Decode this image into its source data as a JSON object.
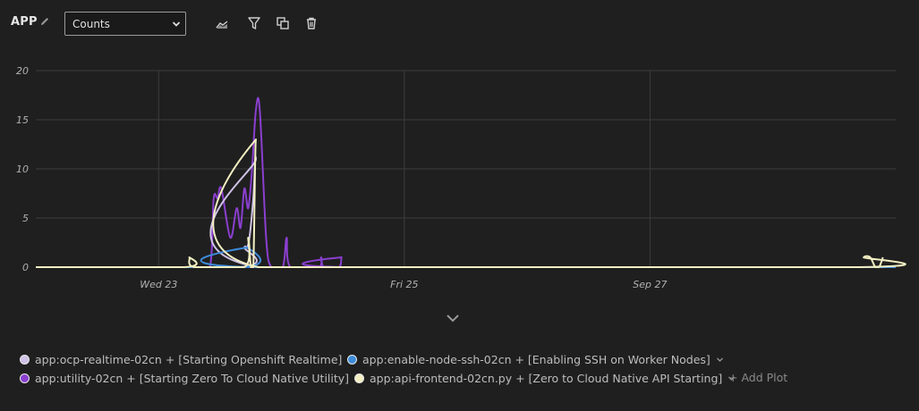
{
  "header": {
    "title": "APP",
    "metric_options": [
      "Counts"
    ],
    "metric_selected": "Counts"
  },
  "colors": {
    "background": "#1f1f1f",
    "grid": "#3c3c3c",
    "series_ocp": "#cfc2e6",
    "series_ssh": "#3d8bd9",
    "series_utility": "#8a3fcf",
    "series_api": "#f3efc2"
  },
  "chart_data": {
    "type": "line",
    "x_range": [
      "Sep 22 00:00",
      "Sep 29 00:00"
    ],
    "ylim": [
      0,
      20
    ],
    "y_ticks": [
      "0",
      "5",
      "10",
      "15",
      "20"
    ],
    "x_ticks": [
      {
        "label": "Wed 23",
        "t": "Sep 23 00:00"
      },
      {
        "label": "Fri 25",
        "t": "Sep 25 00:00"
      },
      {
        "label": "Sep 27",
        "t": "Sep 27 00:00"
      }
    ],
    "grid": true,
    "series": [
      {
        "name": "app:utility-02cn + [Starting Zero To Cloud Native Utility]",
        "color_key": "series_utility",
        "points": [
          [
            "Sep 22 00:00",
            0
          ],
          [
            "Sep 23 07:00",
            0
          ],
          [
            "Sep 23 10:00",
            0
          ],
          [
            "Sep 23 10:45",
            7
          ],
          [
            "Sep 23 11:30",
            7
          ],
          [
            "Sep 23 12:15",
            8
          ],
          [
            "Sep 23 14:00",
            3
          ],
          [
            "Sep 23 15:15",
            6
          ],
          [
            "Sep 23 16:00",
            4
          ],
          [
            "Sep 23 16:45",
            8
          ],
          [
            "Sep 23 17:30",
            6
          ],
          [
            "Sep 23 18:15",
            10
          ],
          [
            "Sep 23 19:00",
            16
          ],
          [
            "Sep 23 19:45",
            16
          ],
          [
            "Sep 23 21:00",
            3
          ],
          [
            "Sep 23 22:00",
            0
          ],
          [
            "Sep 24 00:15",
            0
          ],
          [
            "Sep 24 01:00",
            3
          ],
          [
            "Sep 24 01:45",
            0
          ],
          [
            "Sep 24 07:15",
            0
          ],
          [
            "Sep 24 07:45",
            1
          ],
          [
            "Sep 24 08:15",
            0
          ],
          [
            "Sep 24 11:15",
            0
          ],
          [
            "Sep 24 11:45",
            1
          ],
          [
            "Sep 24 12:15",
            0
          ],
          [
            "Sep 29 00:00",
            0
          ]
        ]
      },
      {
        "name": "app:ocp-realtime-02cn + [Starting Openshift Realtime]",
        "color_key": "series_ocp",
        "points": [
          [
            "Sep 22 00:00",
            0
          ],
          [
            "Sep 23 16:00",
            0
          ],
          [
            "Sep 23 16:45",
            2
          ],
          [
            "Sep 23 17:15",
            2
          ],
          [
            "Sep 23 17:45",
            3
          ],
          [
            "Sep 23 18:30",
            7
          ],
          [
            "Sep 23 19:00",
            11
          ],
          [
            "Sep 23 19:30",
            0
          ],
          [
            "Sep 29 00:00",
            0
          ]
        ]
      },
      {
        "name": "app:enable-node-ssh-02cn + [Enabling SSH on Worker Nodes]",
        "color_key": "series_ssh",
        "points": [
          [
            "Sep 22 00:00",
            0
          ],
          [
            "Sep 23 16:45",
            0
          ],
          [
            "Sep 23 17:15",
            2
          ],
          [
            "Sep 23 17:45",
            0
          ],
          [
            "Sep 29 00:00",
            0
          ]
        ]
      },
      {
        "name": "app:api-frontend-02cn.py + [Zero to Cloud Native API Starting]",
        "color_key": "series_api",
        "points": [
          [
            "Sep 22 00:00",
            0
          ],
          [
            "Sep 23 05:00",
            0
          ],
          [
            "Sep 23 06:00",
            1
          ],
          [
            "Sep 23 07:00",
            0
          ],
          [
            "Sep 23 16:45",
            0
          ],
          [
            "Sep 23 17:30",
            3
          ],
          [
            "Sep 23 18:00",
            0
          ],
          [
            "Sep 23 18:30",
            0
          ],
          [
            "Sep 23 19:00",
            13
          ],
          [
            "Sep 23 19:30",
            0
          ],
          [
            "Sep 28 17:00",
            0
          ],
          [
            "Sep 28 17:45",
            1
          ],
          [
            "Sep 28 19:00",
            1
          ],
          [
            "Sep 28 20:00",
            0
          ],
          [
            "Sep 28 20:45",
            0
          ],
          [
            "Sep 28 21:30",
            1
          ]
        ]
      }
    ]
  },
  "legend": {
    "items": [
      {
        "label": "app:ocp-realtime-02cn + [Starting Openshift Realtime]",
        "color_key": "series_ocp"
      },
      {
        "label": "app:enable-node-ssh-02cn + [Enabling SSH on Worker Nodes]",
        "color_key": "series_ssh"
      },
      {
        "label": "app:utility-02cn + [Starting Zero To Cloud Native Utility]",
        "color_key": "series_utility"
      },
      {
        "label": "app:api-frontend-02cn.py + [Zero to Cloud Native API Starting]",
        "color_key": "series_api"
      }
    ],
    "add_plot": "+ Add Plot"
  },
  "icons": {
    "edit": "pencil-icon",
    "chart_type": "area-chart-icon",
    "filter": "filter-icon",
    "duplicate": "duplicate-icon",
    "delete": "trash-icon",
    "expand": "chevron-down-icon"
  }
}
